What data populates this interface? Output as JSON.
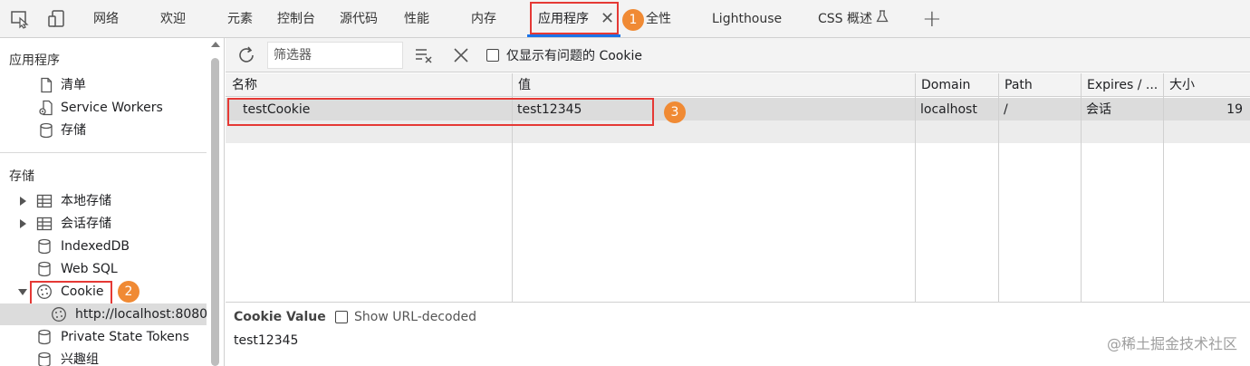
{
  "tabs": [
    {
      "label": "网络"
    },
    {
      "label": "欢迎"
    },
    {
      "label": "元素"
    },
    {
      "label": "控制台"
    },
    {
      "label": "源代码"
    },
    {
      "label": "性能"
    },
    {
      "label": "内存"
    },
    {
      "label": "应用程序",
      "active": true
    },
    {
      "label": "全性"
    },
    {
      "label": "Lighthouse"
    },
    {
      "label": "CSS 概述"
    }
  ],
  "sidebar": {
    "app_section": "应用程序",
    "app_items": [
      "清单",
      "Service Workers",
      "存储"
    ],
    "storage_section": "存储",
    "storage_items": [
      "本地存储",
      "会话存储",
      "IndexedDB",
      "Web SQL",
      "Cookie"
    ],
    "cookie_child": "http://localhost:8080",
    "after_items": [
      "Private State Tokens",
      "兴趣组"
    ]
  },
  "toolbar": {
    "filter_placeholder": "筛选器",
    "only_issues_label": "仅显示有问题的 Cookie"
  },
  "table": {
    "columns": [
      "名称",
      "值",
      "Domain",
      "Path",
      "Expires / ...",
      "大小"
    ],
    "rows": [
      {
        "name": "testCookie",
        "value": "test12345",
        "domain": "localhost",
        "path": "/",
        "expires": "会话",
        "size": "19"
      }
    ]
  },
  "bottom": {
    "cookie_value_label": "Cookie Value",
    "url_decoded_label": "Show URL-decoded",
    "value": "test12345"
  },
  "annotations": [
    "1",
    "2",
    "3"
  ],
  "watermark": "@稀土掘金技术社区",
  "colors": {
    "annotation": "#e53935",
    "badge": "#f08a34",
    "accent": "#1a73e8"
  }
}
